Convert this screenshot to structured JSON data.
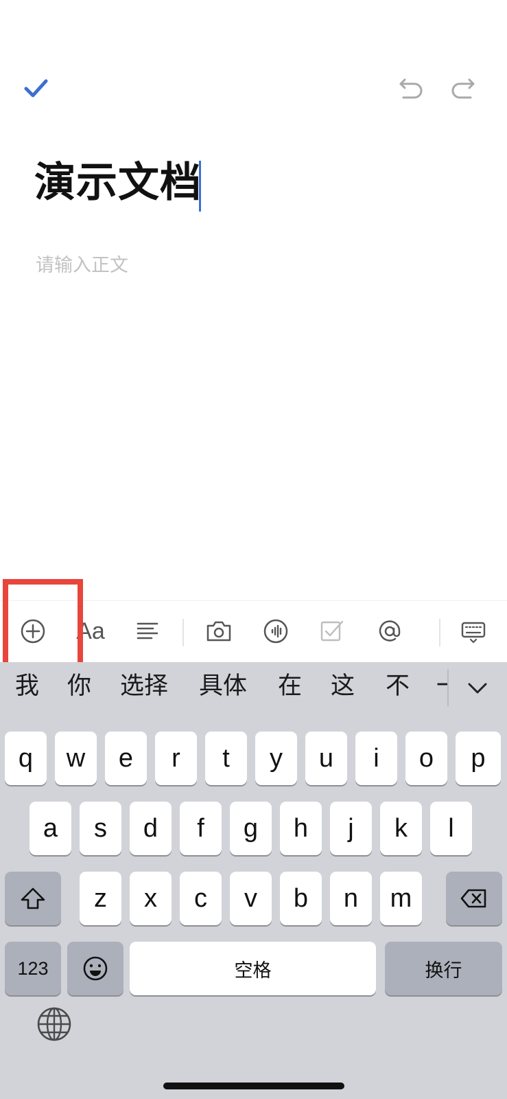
{
  "header": {
    "done_icon": "checkmark-icon",
    "undo_icon": "undo-icon",
    "redo_icon": "redo-icon",
    "accent_color": "#3b6fd1"
  },
  "document": {
    "title": "演示文档",
    "body_placeholder": "请输入正文"
  },
  "toolbar": {
    "items": [
      {
        "name": "insert",
        "icon": "plus-circle-icon"
      },
      {
        "name": "text-style",
        "icon": "text-format-icon",
        "label": "Aa"
      },
      {
        "name": "align",
        "icon": "align-icon"
      },
      {
        "name": "camera",
        "icon": "camera-icon"
      },
      {
        "name": "audio",
        "icon": "audio-icon"
      },
      {
        "name": "checklist",
        "icon": "checkbox-icon"
      },
      {
        "name": "mention",
        "icon": "at-icon"
      },
      {
        "name": "hide-keyboard",
        "icon": "keyboard-icon"
      }
    ],
    "highlight_color": "#e8453c"
  },
  "keyboard": {
    "candidates": [
      "我",
      "你",
      "选择",
      "具体",
      "在",
      "这",
      "不",
      "一"
    ],
    "row1": [
      "q",
      "w",
      "e",
      "r",
      "t",
      "y",
      "u",
      "i",
      "o",
      "p"
    ],
    "row2": [
      "a",
      "s",
      "d",
      "f",
      "g",
      "h",
      "j",
      "k",
      "l"
    ],
    "row3": [
      "z",
      "x",
      "c",
      "v",
      "b",
      "n",
      "m"
    ],
    "numbers_label": "123",
    "space_label": "空格",
    "return_label": "换行"
  }
}
